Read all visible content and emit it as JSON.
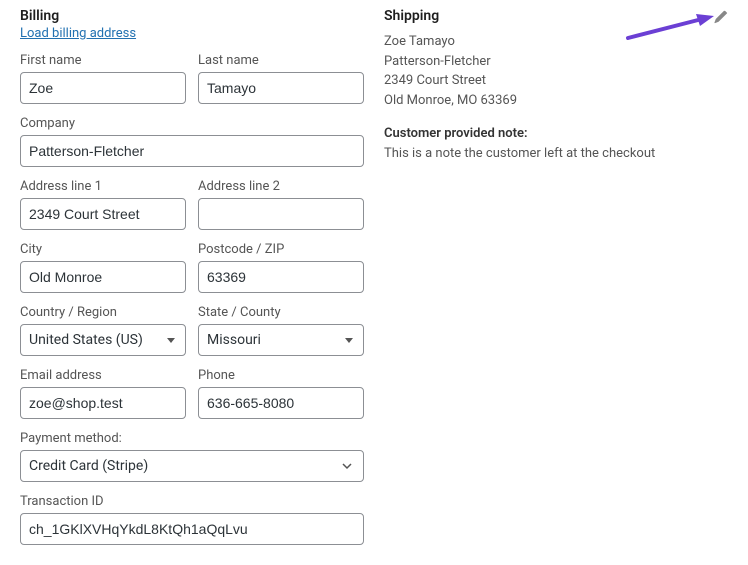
{
  "billing": {
    "heading": "Billing",
    "load_link": "Load billing address",
    "first_name": {
      "label": "First name",
      "value": "Zoe"
    },
    "last_name": {
      "label": "Last name",
      "value": "Tamayo"
    },
    "company": {
      "label": "Company",
      "value": "Patterson-Fletcher"
    },
    "address1": {
      "label": "Address line 1",
      "value": "2349 Court Street"
    },
    "address2": {
      "label": "Address line 2",
      "value": ""
    },
    "city": {
      "label": "City",
      "value": "Old Monroe"
    },
    "postcode": {
      "label": "Postcode / ZIP",
      "value": "63369"
    },
    "country": {
      "label": "Country / Region",
      "value": "United States (US)"
    },
    "state": {
      "label": "State / County",
      "value": "Missouri"
    },
    "email": {
      "label": "Email address",
      "value": "zoe@shop.test"
    },
    "phone": {
      "label": "Phone",
      "value": "636-665-8080"
    },
    "payment_method": {
      "label": "Payment method:",
      "value": "Credit Card (Stripe)"
    },
    "transaction_id": {
      "label": "Transaction ID",
      "value": "ch_1GKlXVHqYkdL8KtQh1aQqLvu"
    }
  },
  "shipping": {
    "heading": "Shipping",
    "name": "Zoe Tamayo",
    "company": "Patterson-Fletcher",
    "street": "2349 Court Street",
    "city_line": "Old Monroe, MO 63369",
    "note_heading": "Customer provided note:",
    "note_text": "This is a note the customer left at the checkout"
  }
}
